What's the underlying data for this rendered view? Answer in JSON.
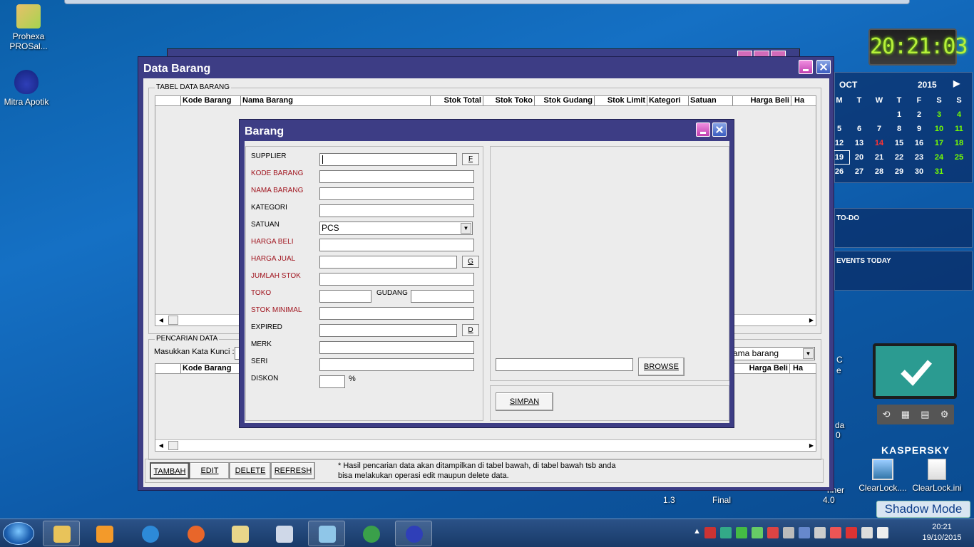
{
  "desktop": {
    "icons": [
      {
        "label": "Prohexa PROSal..."
      },
      {
        "label": "Mitra Apotik"
      }
    ],
    "behind_text": {
      "c": "C",
      "e": "e",
      "da": "da",
      "zero": "0",
      "mid1": "1.3",
      "mid2": "Final",
      "mid3": "4.0",
      "ner": "nner"
    },
    "shortcuts": [
      {
        "label": "ClearLock...."
      },
      {
        "label": "ClearLock.ini"
      }
    ]
  },
  "gadgets": {
    "clock": "20:21:03",
    "calendar": {
      "month": "OCT",
      "year": "2015",
      "weekdays": [
        "M",
        "T",
        "W",
        "T",
        "F",
        "S",
        "S"
      ],
      "rows": [
        [
          "",
          "",
          "",
          "1",
          "2",
          "3",
          "4"
        ],
        [
          "5",
          "6",
          "7",
          "8",
          "9",
          "10",
          "11"
        ],
        [
          "12",
          "13",
          "14",
          "15",
          "16",
          "17",
          "18"
        ],
        [
          "19",
          "20",
          "21",
          "22",
          "23",
          "24",
          "25"
        ],
        [
          "26",
          "27",
          "28",
          "29",
          "30",
          "31",
          ""
        ]
      ]
    },
    "todo": "TO-DO",
    "events": "EVENTS TODAY",
    "kaspersky": "KASPERSKY",
    "shadow_mode": "Shadow Mode"
  },
  "taskbar": {
    "time": "20:21",
    "date": "19/10/2015"
  },
  "main": {
    "title": "Data Barang",
    "table_group": "TABEL DATA BARANG",
    "columns": [
      "Kode Barang",
      "Nama Barang",
      "Stok Total",
      "Stok Toko",
      "Stok Gudang",
      "Stok Limit",
      "Kategori",
      "Satuan",
      "Harga Beli",
      "Ha"
    ],
    "search_group": "PENCARIAN DATA",
    "search_label": "Masukkan Kata Kunci :",
    "search_field_value": "ama barang",
    "result_columns": {
      "kode": "Kode Barang",
      "harga_beli": "Harga Beli",
      "ha": "Ha"
    },
    "buttons": {
      "tambah": "TAMBAH",
      "edit": "EDIT",
      "delete": "DELETE",
      "refresh": "REFRESH"
    },
    "note_line1": "* Hasil pencarian data akan ditampilkan di tabel bawah, di tabel bawah tsb anda",
    "note_line2": "bisa melakukan operasi edit maupun delete data."
  },
  "dialog": {
    "title": "Barang",
    "labels": {
      "supplier": "SUPPLIER",
      "kode": "KODE BARANG",
      "nama": "NAMA BARANG",
      "kategori": "KATEGORI",
      "satuan": "SATUAN",
      "harga_beli": "HARGA BELI",
      "harga_jual": "HARGA JUAL",
      "jumlah_stok": "JUMLAH STOK",
      "toko": "TOKO",
      "gudang": "GUDANG",
      "stok_minimal": "STOK MINIMAL",
      "expired": "EXPIRED",
      "merk": "MERK",
      "seri": "SERI",
      "diskon": "DISKON",
      "percent": "%"
    },
    "satuan_value": "PCS",
    "small_buttons": {
      "f": "F",
      "g": "G",
      "d": "D"
    },
    "browse": "BROWSE",
    "simpan": "SIMPAN"
  }
}
